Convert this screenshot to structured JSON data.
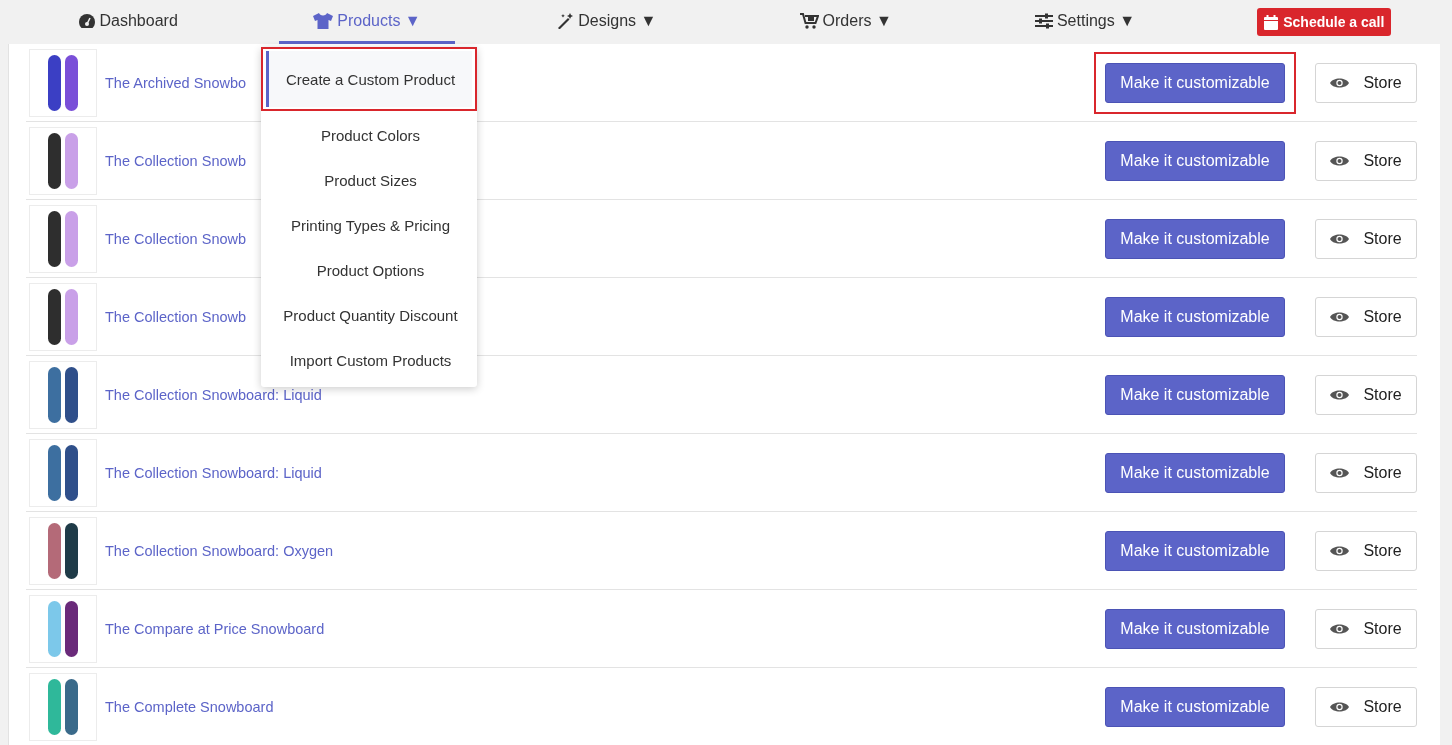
{
  "nav": {
    "items": [
      {
        "label": "Dashboard",
        "selected": false
      },
      {
        "label": "Products",
        "caret": "▼",
        "selected": true
      },
      {
        "label": "Designs",
        "caret": "▼",
        "selected": false
      },
      {
        "label": "Orders",
        "caret": "▼",
        "selected": false
      },
      {
        "label": "Settings",
        "caret": "▼",
        "selected": false
      }
    ],
    "cta": {
      "label": "Schedule a call"
    }
  },
  "menu": {
    "items": [
      {
        "label": "Create a Custom Product",
        "selected": true,
        "highlighted": true
      },
      {
        "label": "Product Colors",
        "selected": false,
        "highlighted": false
      },
      {
        "label": "Product Sizes",
        "selected": false,
        "highlighted": false
      },
      {
        "label": "Printing Types & Pricing",
        "selected": false,
        "highlighted": false
      },
      {
        "label": "Product Options",
        "selected": false,
        "highlighted": false
      },
      {
        "label": "Product Quantity Discount",
        "selected": false,
        "highlighted": false
      },
      {
        "label": "Import Custom Products",
        "selected": false,
        "highlighted": false
      }
    ]
  },
  "products": [
    {
      "name": "The Archived Snowbo",
      "action": "Make it customizable",
      "store": "Store",
      "highlighted": true
    },
    {
      "name": "The Collection Snowb",
      "action": "Make it customizable",
      "store": "Store",
      "highlighted": false
    },
    {
      "name": "The Collection Snowb",
      "action": "Make it customizable",
      "store": "Store",
      "highlighted": false
    },
    {
      "name": "The Collection Snowb",
      "action": "Make it customizable",
      "store": "Store",
      "highlighted": false
    },
    {
      "name": "The Collection Snowboard: Liquid",
      "action": "Make it customizable",
      "store": "Store",
      "highlighted": false
    },
    {
      "name": "The Collection Snowboard: Liquid",
      "action": "Make it customizable",
      "store": "Store",
      "highlighted": false
    },
    {
      "name": "The Collection Snowboard: Oxygen",
      "action": "Make it customizable",
      "store": "Store",
      "highlighted": false
    },
    {
      "name": "The Compare at Price Snowboard",
      "action": "Make it customizable",
      "store": "Store",
      "highlighted": false
    },
    {
      "name": "The Complete Snowboard",
      "action": "Make it customizable",
      "store": "Store",
      "highlighted": false
    }
  ]
}
